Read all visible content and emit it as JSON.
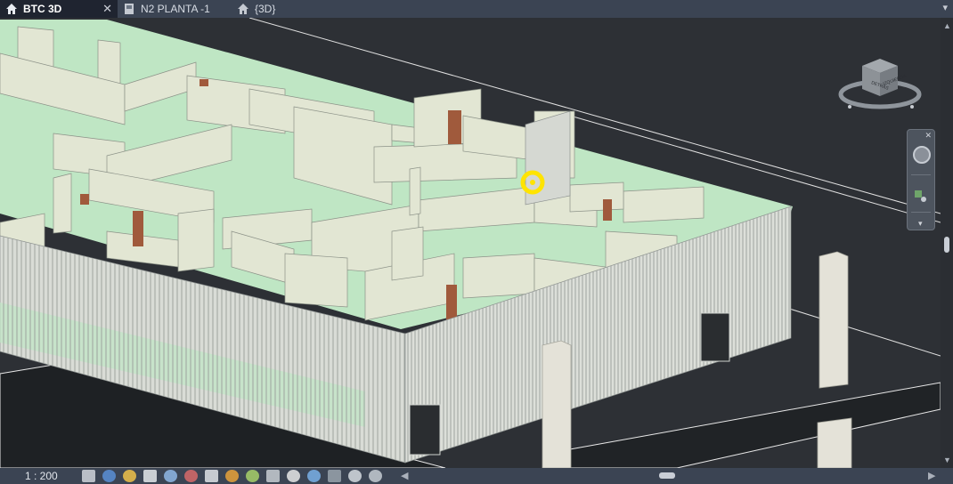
{
  "tabs": [
    {
      "label": "BTC 3D",
      "icon": "home-icon",
      "active": true,
      "closable": true
    },
    {
      "label": "N2 PLANTA -1",
      "icon": "floor-plan-icon",
      "active": false,
      "closable": false
    },
    {
      "label": "{3D}",
      "icon": "home-icon",
      "active": false,
      "closable": false
    }
  ],
  "tab_close_glyph": "✕",
  "tab_dropdown_glyph": "▾",
  "viewcube": {
    "face_front": "DETRÁS",
    "face_side": "IZQUIERDA"
  },
  "navbar": {
    "close_glyph": "✕",
    "menu_glyph": "▾"
  },
  "statusbar": {
    "scale": "1 : 200",
    "icons": [
      "detail-level-icon",
      "visual-style-icon",
      "sun-path-icon",
      "shadows-icon",
      "render-icon",
      "crop-view-icon",
      "show-crop-icon",
      "unlock-3d-icon",
      "temporary-hide-icon",
      "reveal-hidden-icon",
      "worksharing-icon",
      "highlight-displacement-icon",
      "analytical-model-icon",
      "reveal-constraints-icon",
      "section-box-icon"
    ]
  },
  "colors": {
    "tabbar": "#3b4453",
    "tab_active": "#1f2430",
    "viewport_bg": "#2d3035",
    "floor_green": "#bfe6c4",
    "wall": "#e2e6d3",
    "facade": "#d9dcd6",
    "highlight": "#ffe400",
    "door": "#a05a3c"
  }
}
